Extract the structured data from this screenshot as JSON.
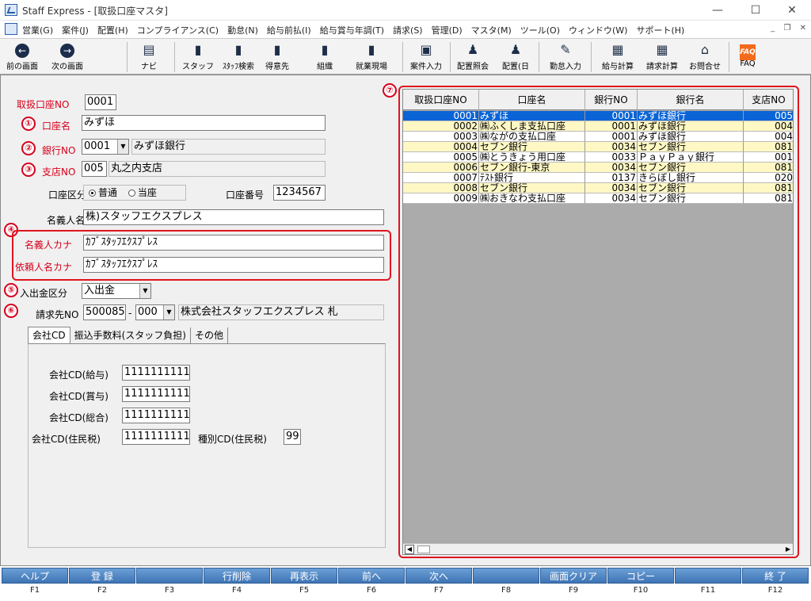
{
  "window": {
    "title": "Staff Express - [取扱口座マスタ]"
  },
  "menu": [
    "営業(G)",
    "案件(J)",
    "配置(H)",
    "コンプライアンス(C)",
    "勤怠(N)",
    "給与前払(I)",
    "給与賞与年調(T)",
    "請求(S)",
    "管理(D)",
    "マスタ(M)",
    "ツール(O)",
    "ウィンドウ(W)",
    "サポート(H)"
  ],
  "toolbar": {
    "prev": "前の画面",
    "next": "次の画面",
    "navi": "ナビ",
    "staff": "スタッフ",
    "staff_search": "ｽﾀｯﾌ検索",
    "client": "得意先",
    "org": "組織",
    "site": "就業現場",
    "job_input": "案件入力",
    "placement_query": "配置照会",
    "placement_day": "配置(日",
    "attendance": "勤怠入力",
    "payroll": "給与計算",
    "billing": "請求計算",
    "contact": "お問合せ",
    "faq": "FAQ",
    "faq_icon": "FAQ"
  },
  "badges": [
    "①",
    "②",
    "③",
    "④",
    "⑤",
    "⑥",
    "⑦"
  ],
  "form": {
    "account_no_label": "取扱口座NO",
    "account_no": "0001",
    "account_name_label": "口座名",
    "account_name": "みずほ",
    "bank_no_label": "銀行NO",
    "bank_no": "0001",
    "bank_name": "みずほ銀行",
    "branch_no_label": "支店NO",
    "branch_no": "005",
    "branch_name": "丸之内支店",
    "account_type_label": "口座区分",
    "type_normal": "普通",
    "type_current": "当座",
    "account_number_label": "口座番号",
    "account_number": "1234567",
    "holder_label": "名義人名",
    "holder": "株)スタッフエクスプレス",
    "holder_kana_label": "名義人カナ",
    "holder_kana": "ｶﾌﾞｽﾀｯﾌｴｸｽﾌﾟﾚｽ",
    "requester_kana_label": "依頼人名カナ",
    "requester_kana": "ｶﾌﾞｽﾀｯﾌｴｸｽﾌﾟﾚｽ",
    "inout_label": "入出金区分",
    "inout": "入出金",
    "billing_label": "請求先NO",
    "billing_no": "500085",
    "billing_sep": "-",
    "billing_sub": "000",
    "billing_name": "株式会社スタッフエクスプレス 札"
  },
  "tabs": [
    "会社CD",
    "振込手数料(スタッフ負担)",
    "その他"
  ],
  "company": {
    "salary_label": "会社CD(給与)",
    "salary": "1111111111",
    "bonus_label": "会社CD(賞与)",
    "bonus": "1111111111",
    "total_label": "会社CD(総合)",
    "total": "1111111111",
    "resident_label": "会社CD(住民税)",
    "resident": "1111111111",
    "kind_label": "種別CD(住民税)",
    "kind": "99"
  },
  "grid": {
    "headers": [
      "取扱口座NO",
      "口座名",
      "銀行NO",
      "銀行名",
      "支店NO"
    ],
    "rows": [
      [
        "0001",
        "みずほ",
        "0001",
        "みずほ銀行",
        "005"
      ],
      [
        "0002",
        "㈱ふくしま支払口座",
        "0001",
        "みずほ銀行",
        "004"
      ],
      [
        "0003",
        "㈱ながの支払口座",
        "0001",
        "みずほ銀行",
        "004"
      ],
      [
        "0004",
        "セブン銀行",
        "0034",
        "セブン銀行",
        "081"
      ],
      [
        "0005",
        "㈱とうきょう用口座",
        "0033",
        "ＰａｙＰａｙ銀行",
        "001"
      ],
      [
        "0006",
        "セブン銀行-東京",
        "0034",
        "セブン銀行",
        "081"
      ],
      [
        "0007",
        "ﾃｽﾄ銀行",
        "0137",
        "きらぼし銀行",
        "020"
      ],
      [
        "0008",
        "セブン銀行",
        "0034",
        "セブン銀行",
        "081"
      ],
      [
        "0009",
        "㈱おきなわ支払口座",
        "0034",
        "セブン銀行",
        "081"
      ]
    ]
  },
  "fkeys": [
    {
      "label": "ヘルプ",
      "key": "F1"
    },
    {
      "label": "登 録",
      "key": "F2"
    },
    {
      "label": "",
      "key": "F3"
    },
    {
      "label": "行削除",
      "key": "F4"
    },
    {
      "label": "再表示",
      "key": "F5"
    },
    {
      "label": "前へ",
      "key": "F6"
    },
    {
      "label": "次へ",
      "key": "F7"
    },
    {
      "label": "",
      "key": "F8"
    },
    {
      "label": "画面クリア",
      "key": "F9"
    },
    {
      "label": "コピー",
      "key": "F10"
    },
    {
      "label": "",
      "key": "F11"
    },
    {
      "label": "終 了",
      "key": "F12"
    }
  ],
  "colors": {
    "selected_row": "#0a64d6",
    "yellow_row": "#fff8c4",
    "accent_red": "#d6001c",
    "fkey_blue": "#4a80c0"
  }
}
